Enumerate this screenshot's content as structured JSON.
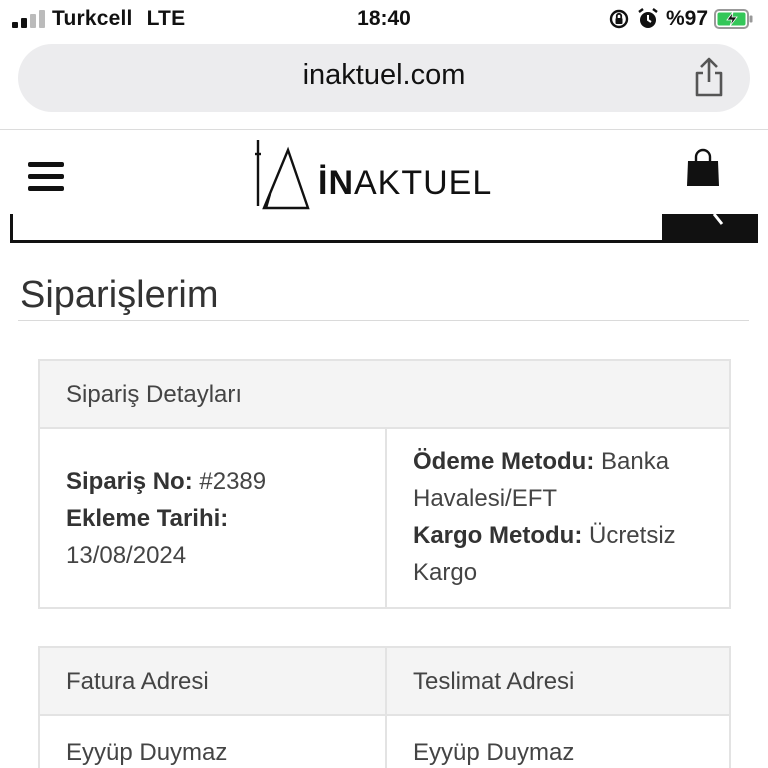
{
  "status_bar": {
    "carrier": "Turkcell",
    "network": "LTE",
    "time": "18:40",
    "battery": "%97",
    "icons": [
      "signal-icon",
      "orientation-lock-icon",
      "alarm-icon",
      "battery-charging-icon"
    ]
  },
  "browser": {
    "url": "inaktuel.com",
    "share_icon": "share-icon"
  },
  "site_header": {
    "menu_icon": "hamburger-icon",
    "logo_bold": "İN",
    "logo_rest": "AKTUEL",
    "cart_icon": "shopping-bag-icon"
  },
  "page": {
    "title": "Siparişlerim"
  },
  "order_details": {
    "header": "Sipariş Detayları",
    "order_no_label": "Sipariş No:",
    "order_no_value": "#2389",
    "date_label": "Ekleme Tarihi:",
    "date_value": "13/08/2024",
    "payment_label": "Ödeme Metodu:",
    "payment_value": "Banka Havalesi/EFT",
    "shipping_label": "Kargo Metodu:",
    "shipping_value": "Ücretsiz Kargo"
  },
  "addresses": {
    "billing_header": "Fatura Adresi",
    "shipping_header": "Teslimat Adresi",
    "billing_name": "Eyyüp Duymaz",
    "shipping_name": "Eyyüp Duymaz"
  },
  "colors": {
    "text": "#444444",
    "header_bg": "#f4f4f4",
    "border": "#e3e3e3",
    "battery_green": "#34c759"
  }
}
